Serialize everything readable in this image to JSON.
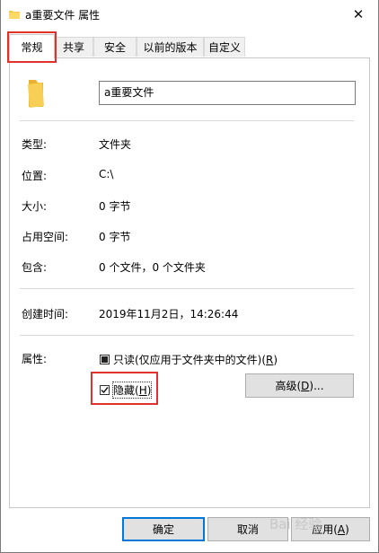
{
  "window": {
    "title": "a重要文件 属性",
    "close_glyph": "✕"
  },
  "tabs": [
    {
      "label": "常规",
      "active": true
    },
    {
      "label": "共享"
    },
    {
      "label": "安全"
    },
    {
      "label": "以前的版本"
    },
    {
      "label": "自定义"
    }
  ],
  "general": {
    "name_value": "a重要文件",
    "rows": [
      {
        "label": "类型:",
        "value": "文件夹"
      },
      {
        "label": "位置:",
        "value": "C:\\"
      },
      {
        "label": "大小:",
        "value": "0 字节"
      },
      {
        "label": "占用空间:",
        "value": "0 字节"
      },
      {
        "label": "包含:",
        "value": "0 个文件，0 个文件夹"
      }
    ],
    "created_label": "创建时间:",
    "created_value": "2019年11月2日，14:26:44",
    "attributes_label": "属性:",
    "readonly": {
      "text": "只读(仅应用于文件夹中的文件)(",
      "key": "R",
      "suffix": ")",
      "state": "indeterminate"
    },
    "hidden": {
      "text": "隐藏(",
      "key": "H",
      "suffix": ")",
      "checked": true
    },
    "advanced_button": {
      "text": "高级(",
      "key": "D",
      "suffix": ")..."
    }
  },
  "footer": {
    "ok": "确定",
    "cancel": "取消",
    "apply": {
      "text": "应用(",
      "key": "A",
      "suffix": ")"
    }
  },
  "watermark": "Bai 经验",
  "colors": {
    "highlight": "#e0312b",
    "folder": "#f4c948",
    "default_button_border": "#0078d7"
  }
}
